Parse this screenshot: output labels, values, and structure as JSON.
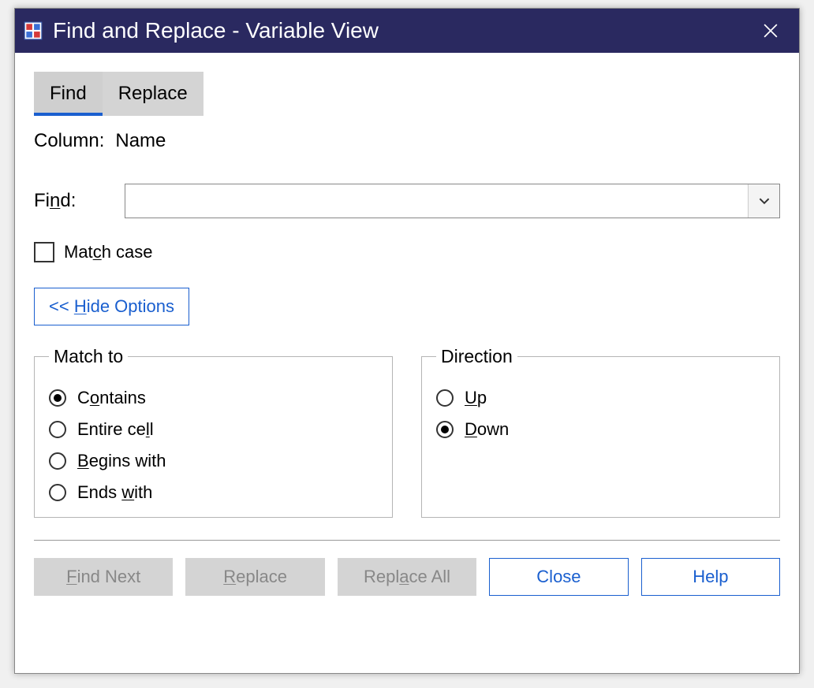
{
  "title": "Find and Replace - Variable View",
  "tabs": {
    "find": "Find",
    "replace": "Replace"
  },
  "column_label": "Column:",
  "column_value": "Name",
  "find_label_pre": "Fi",
  "find_label_u": "n",
  "find_label_post": "d:",
  "find_value": "",
  "match_case_pre": "Mat",
  "match_case_u": "c",
  "match_case_post": "h case",
  "options_btn_pre": "<< ",
  "options_btn_u": "H",
  "options_btn_post": "ide Options",
  "match_to_legend": "Match to",
  "match_opts": {
    "contains_pre": "C",
    "contains_u": "o",
    "contains_post": "ntains",
    "entire_pre": "Entire ce",
    "entire_u": "l",
    "entire_post": "l",
    "begins_pre": "",
    "begins_u": "B",
    "begins_post": "egins with",
    "ends_pre": "Ends ",
    "ends_u": "w",
    "ends_post": "ith"
  },
  "direction_legend": "Direction",
  "dir_opts": {
    "up_pre": "",
    "up_u": "U",
    "up_post": "p",
    "down_pre": "",
    "down_u": "D",
    "down_post": "own"
  },
  "buttons": {
    "find_next_pre": "",
    "find_next_u": "F",
    "find_next_post": "ind Next",
    "replace_pre": "",
    "replace_u": "R",
    "replace_post": "eplace",
    "replace_all_pre": "Repl",
    "replace_all_u": "a",
    "replace_all_post": "ce All",
    "close": "Close",
    "help": "Help"
  }
}
